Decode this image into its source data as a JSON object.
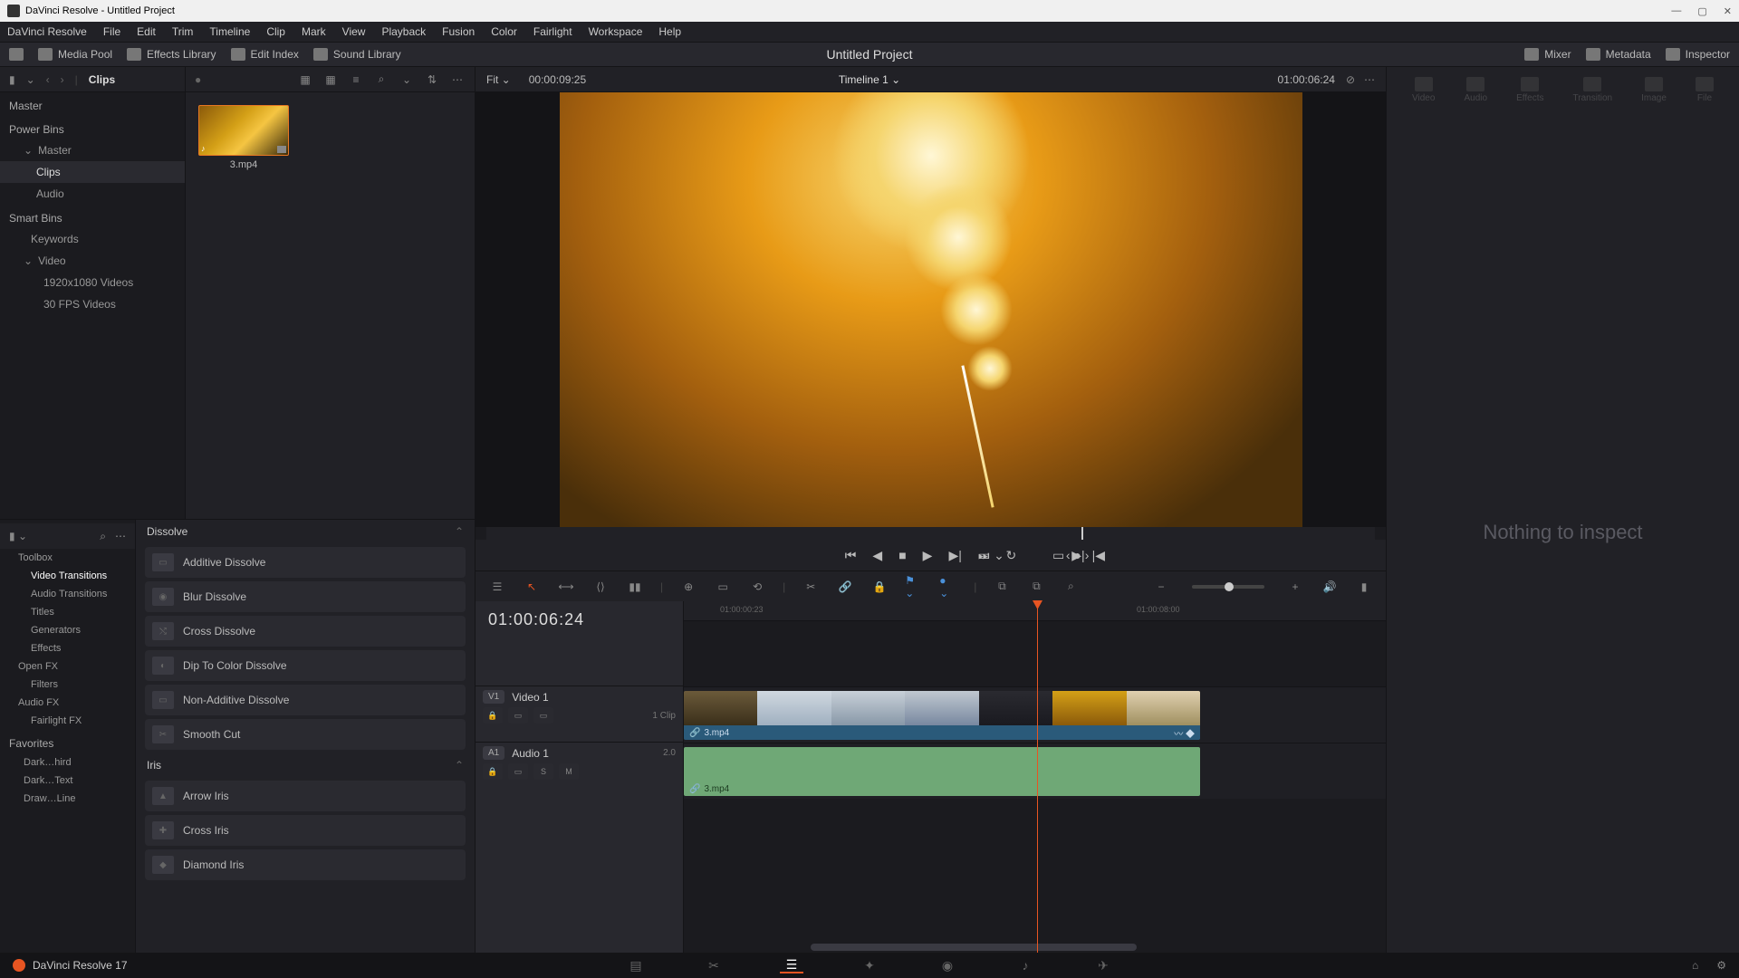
{
  "titlebar": {
    "app": "DaVinci Resolve",
    "project": "Untitled Project"
  },
  "menubar": [
    "DaVinci Resolve",
    "File",
    "Edit",
    "Trim",
    "Timeline",
    "Clip",
    "Mark",
    "View",
    "Playback",
    "Fusion",
    "Color",
    "Fairlight",
    "Workspace",
    "Help"
  ],
  "toolbar": {
    "media_pool": "Media Pool",
    "effects_library": "Effects Library",
    "edit_index": "Edit Index",
    "sound_library": "Sound Library",
    "project_title": "Untitled Project",
    "mixer": "Mixer",
    "metadata": "Metadata",
    "inspector": "Inspector"
  },
  "clips_header": {
    "title": "Clips"
  },
  "bins": {
    "master": "Master",
    "power_bins": "Power Bins",
    "power_master": "Master",
    "power_items": [
      "Clips",
      "Audio"
    ],
    "smart_bins": "Smart Bins",
    "smart_items": [
      "Keywords",
      "Video",
      "1920x1080 Videos",
      "30 FPS Videos"
    ]
  },
  "clip": {
    "name": "3.mp4"
  },
  "fx_tree": {
    "toolbox": "Toolbox",
    "items": [
      "Video Transitions",
      "Audio Transitions",
      "Titles",
      "Generators",
      "Effects"
    ],
    "open_fx": "Open FX",
    "filters": "Filters",
    "audio_fx": "Audio FX",
    "fairlight": "Fairlight FX",
    "favorites": "Favorites",
    "fav_items": [
      "Dark…hird",
      "Dark…Text",
      "Draw…Line"
    ]
  },
  "fx_list": {
    "group1": "Dissolve",
    "g1_items": [
      "Additive Dissolve",
      "Blur Dissolve",
      "Cross Dissolve",
      "Dip To Color Dissolve",
      "Non-Additive Dissolve",
      "Smooth Cut"
    ],
    "group2": "Iris",
    "g2_items": [
      "Arrow Iris",
      "Cross Iris",
      "Diamond Iris"
    ]
  },
  "viewer_header": {
    "fit": "Fit",
    "tc_in": "00:00:09:25",
    "timeline": "Timeline 1",
    "tc_right": "01:00:06:24"
  },
  "timeline": {
    "tc": "01:00:06:24",
    "ruler": [
      "01:00:00:23",
      "01:00:08:00"
    ],
    "video_track": {
      "tag": "V1",
      "name": "Video 1",
      "clip_count": "1 Clip",
      "clip_name": "3.mp4"
    },
    "audio_track": {
      "tag": "A1",
      "name": "Audio 1",
      "ch": "2.0",
      "solo": "S",
      "mute": "M",
      "clip_name": "3.mp4"
    }
  },
  "inspector": {
    "tabs": [
      "Video",
      "Audio",
      "Effects",
      "Transition",
      "Image",
      "File"
    ],
    "empty": "Nothing to inspect"
  },
  "bottombar": {
    "app": "DaVinci Resolve 17"
  }
}
